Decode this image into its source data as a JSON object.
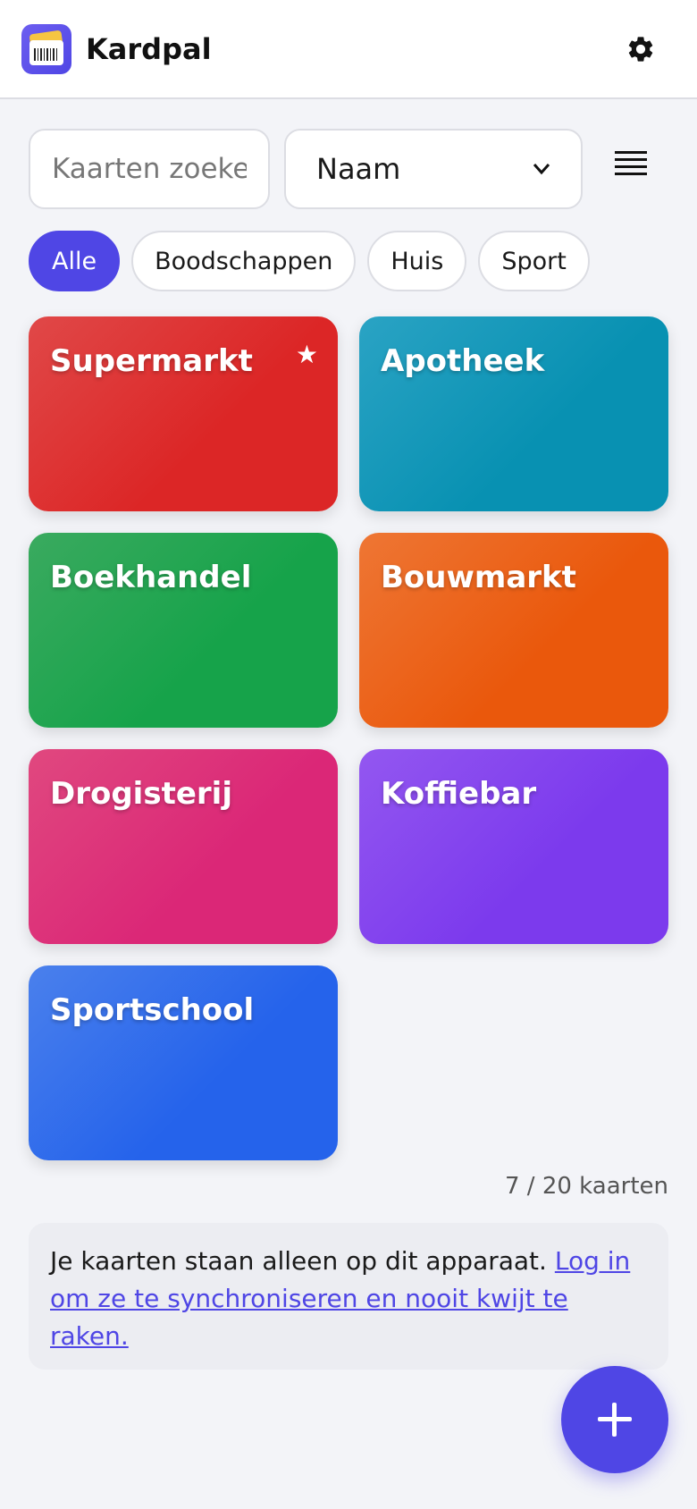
{
  "app": {
    "title": "Kardpal",
    "logo_icon": "wallet-card-icon"
  },
  "header": {
    "settings_icon": "gear-icon"
  },
  "search": {
    "placeholder": "Kaarten zoeken"
  },
  "sort": {
    "selected": "Naam",
    "icon": "chevron-down-icon"
  },
  "view_toggle": {
    "icon": "list-view-icon"
  },
  "filters": {
    "chips": [
      {
        "label": "Alle",
        "active": true
      },
      {
        "label": "Boodschappen",
        "active": false
      },
      {
        "label": "Huis",
        "active": false
      },
      {
        "label": "Sport",
        "active": false
      }
    ]
  },
  "cards": [
    {
      "name": "Supermarkt",
      "favorite": true,
      "color_from": "#e04848",
      "color_to": "#dc2626"
    },
    {
      "name": "Apotheek",
      "favorite": false,
      "color_from": "#2aa3c4",
      "color_to": "#0891b2"
    },
    {
      "name": "Boekhandel",
      "favorite": false,
      "color_from": "#3aaa5f",
      "color_to": "#16a34a"
    },
    {
      "name": "Bouwmarkt",
      "favorite": false,
      "color_from": "#ee7634",
      "color_to": "#ea580c"
    },
    {
      "name": "Drogisterij",
      "favorite": false,
      "color_from": "#e0487f",
      "color_to": "#db2777"
    },
    {
      "name": "Koffiebar",
      "favorite": false,
      "color_from": "#9357f0",
      "color_to": "#7c3aed"
    },
    {
      "name": "Sportschool",
      "favorite": false,
      "color_from": "#4a80ec",
      "color_to": "#2563eb"
    }
  ],
  "count_text": "7 / 20 kaarten",
  "notice": {
    "text": "Je kaarten staan alleen op dit apparaat. ",
    "link": "Log in om ze te synchroniseren en nooit kwijt te raken."
  },
  "fab": {
    "icon": "plus-icon"
  },
  "colors": {
    "accent": "#4f46e5",
    "background": "#f3f4f8"
  }
}
